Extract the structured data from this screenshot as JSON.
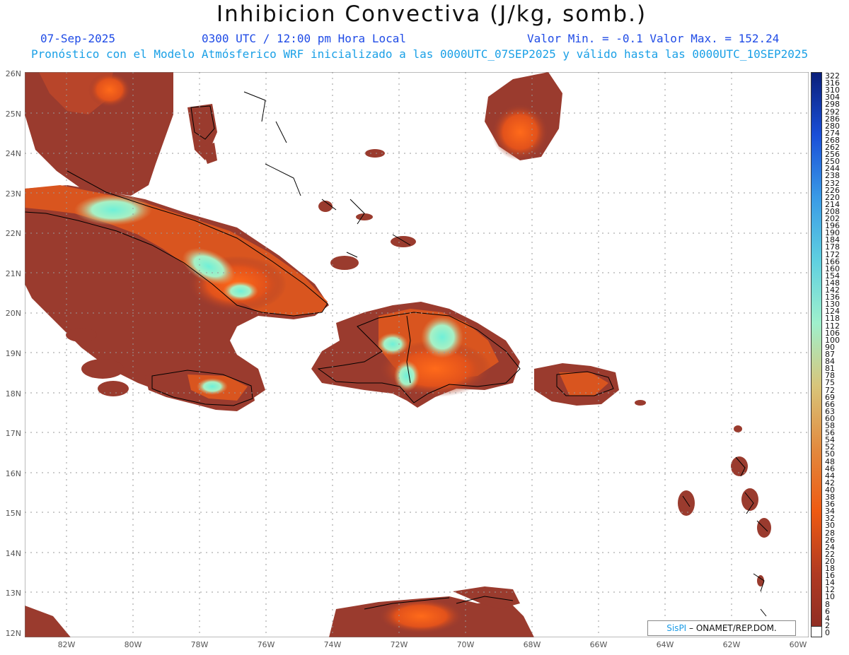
{
  "header": {
    "title": "Inhibicion Convectiva (J/kg, somb.)",
    "date": "07-Sep-2025",
    "time": "0300 UTC / 12:00 pm Hora Local",
    "minmax": "Valor Min. = -0.1  Valor Max. = 152.24",
    "subtitle": "Pronóstico con el Modelo Atmósferico WRF inicializado a las 0000UTC_07SEP2025 y válido hasta las  0000UTC_10SEP2025"
  },
  "map": {
    "lat_labels": [
      "26N",
      "25N",
      "24N",
      "23N",
      "22N",
      "21N",
      "20N",
      "19N",
      "18N",
      "17N",
      "16N",
      "15N",
      "14N",
      "13N",
      "12N"
    ],
    "lon_labels": [
      "82W",
      "80W",
      "78W",
      "76W",
      "74W",
      "72W",
      "70W",
      "68W",
      "66W",
      "64W",
      "62W",
      "60W"
    ],
    "ocean_color": "#ffffff",
    "land_base_color": "#9a3b2e",
    "coastline_color": "#000000",
    "gridline_color": "#9a9a9a"
  },
  "colorbar": {
    "labels": [
      "322",
      "316",
      "310",
      "304",
      "298",
      "292",
      "286",
      "280",
      "274",
      "268",
      "262",
      "256",
      "250",
      "244",
      "238",
      "232",
      "226",
      "220",
      "214",
      "208",
      "202",
      "196",
      "190",
      "184",
      "178",
      "172",
      "166",
      "160",
      "154",
      "148",
      "142",
      "136",
      "130",
      "124",
      "118",
      "112",
      "106",
      "100",
      "90",
      "87",
      "84",
      "81",
      "78",
      "75",
      "72",
      "69",
      "66",
      "63",
      "60",
      "58",
      "56",
      "54",
      "52",
      "50",
      "48",
      "46",
      "44",
      "42",
      "40",
      "38",
      "36",
      "34",
      "32",
      "30",
      "28",
      "26",
      "24",
      "22",
      "20",
      "18",
      "16",
      "14",
      "12",
      "10",
      "8",
      "6",
      "4",
      "2",
      "0"
    ],
    "stops": [
      "#0a1f7a",
      "#1a4fd8",
      "#3a9be6",
      "#5fd0e0",
      "#9ff0cc",
      "#d8c57a",
      "#e28a3f",
      "#ee5a12",
      "#b03a22",
      "#8a2c24"
    ]
  },
  "credit": {
    "logo": "SisPI",
    "org": " – ONAMET/REP.DOM."
  }
}
